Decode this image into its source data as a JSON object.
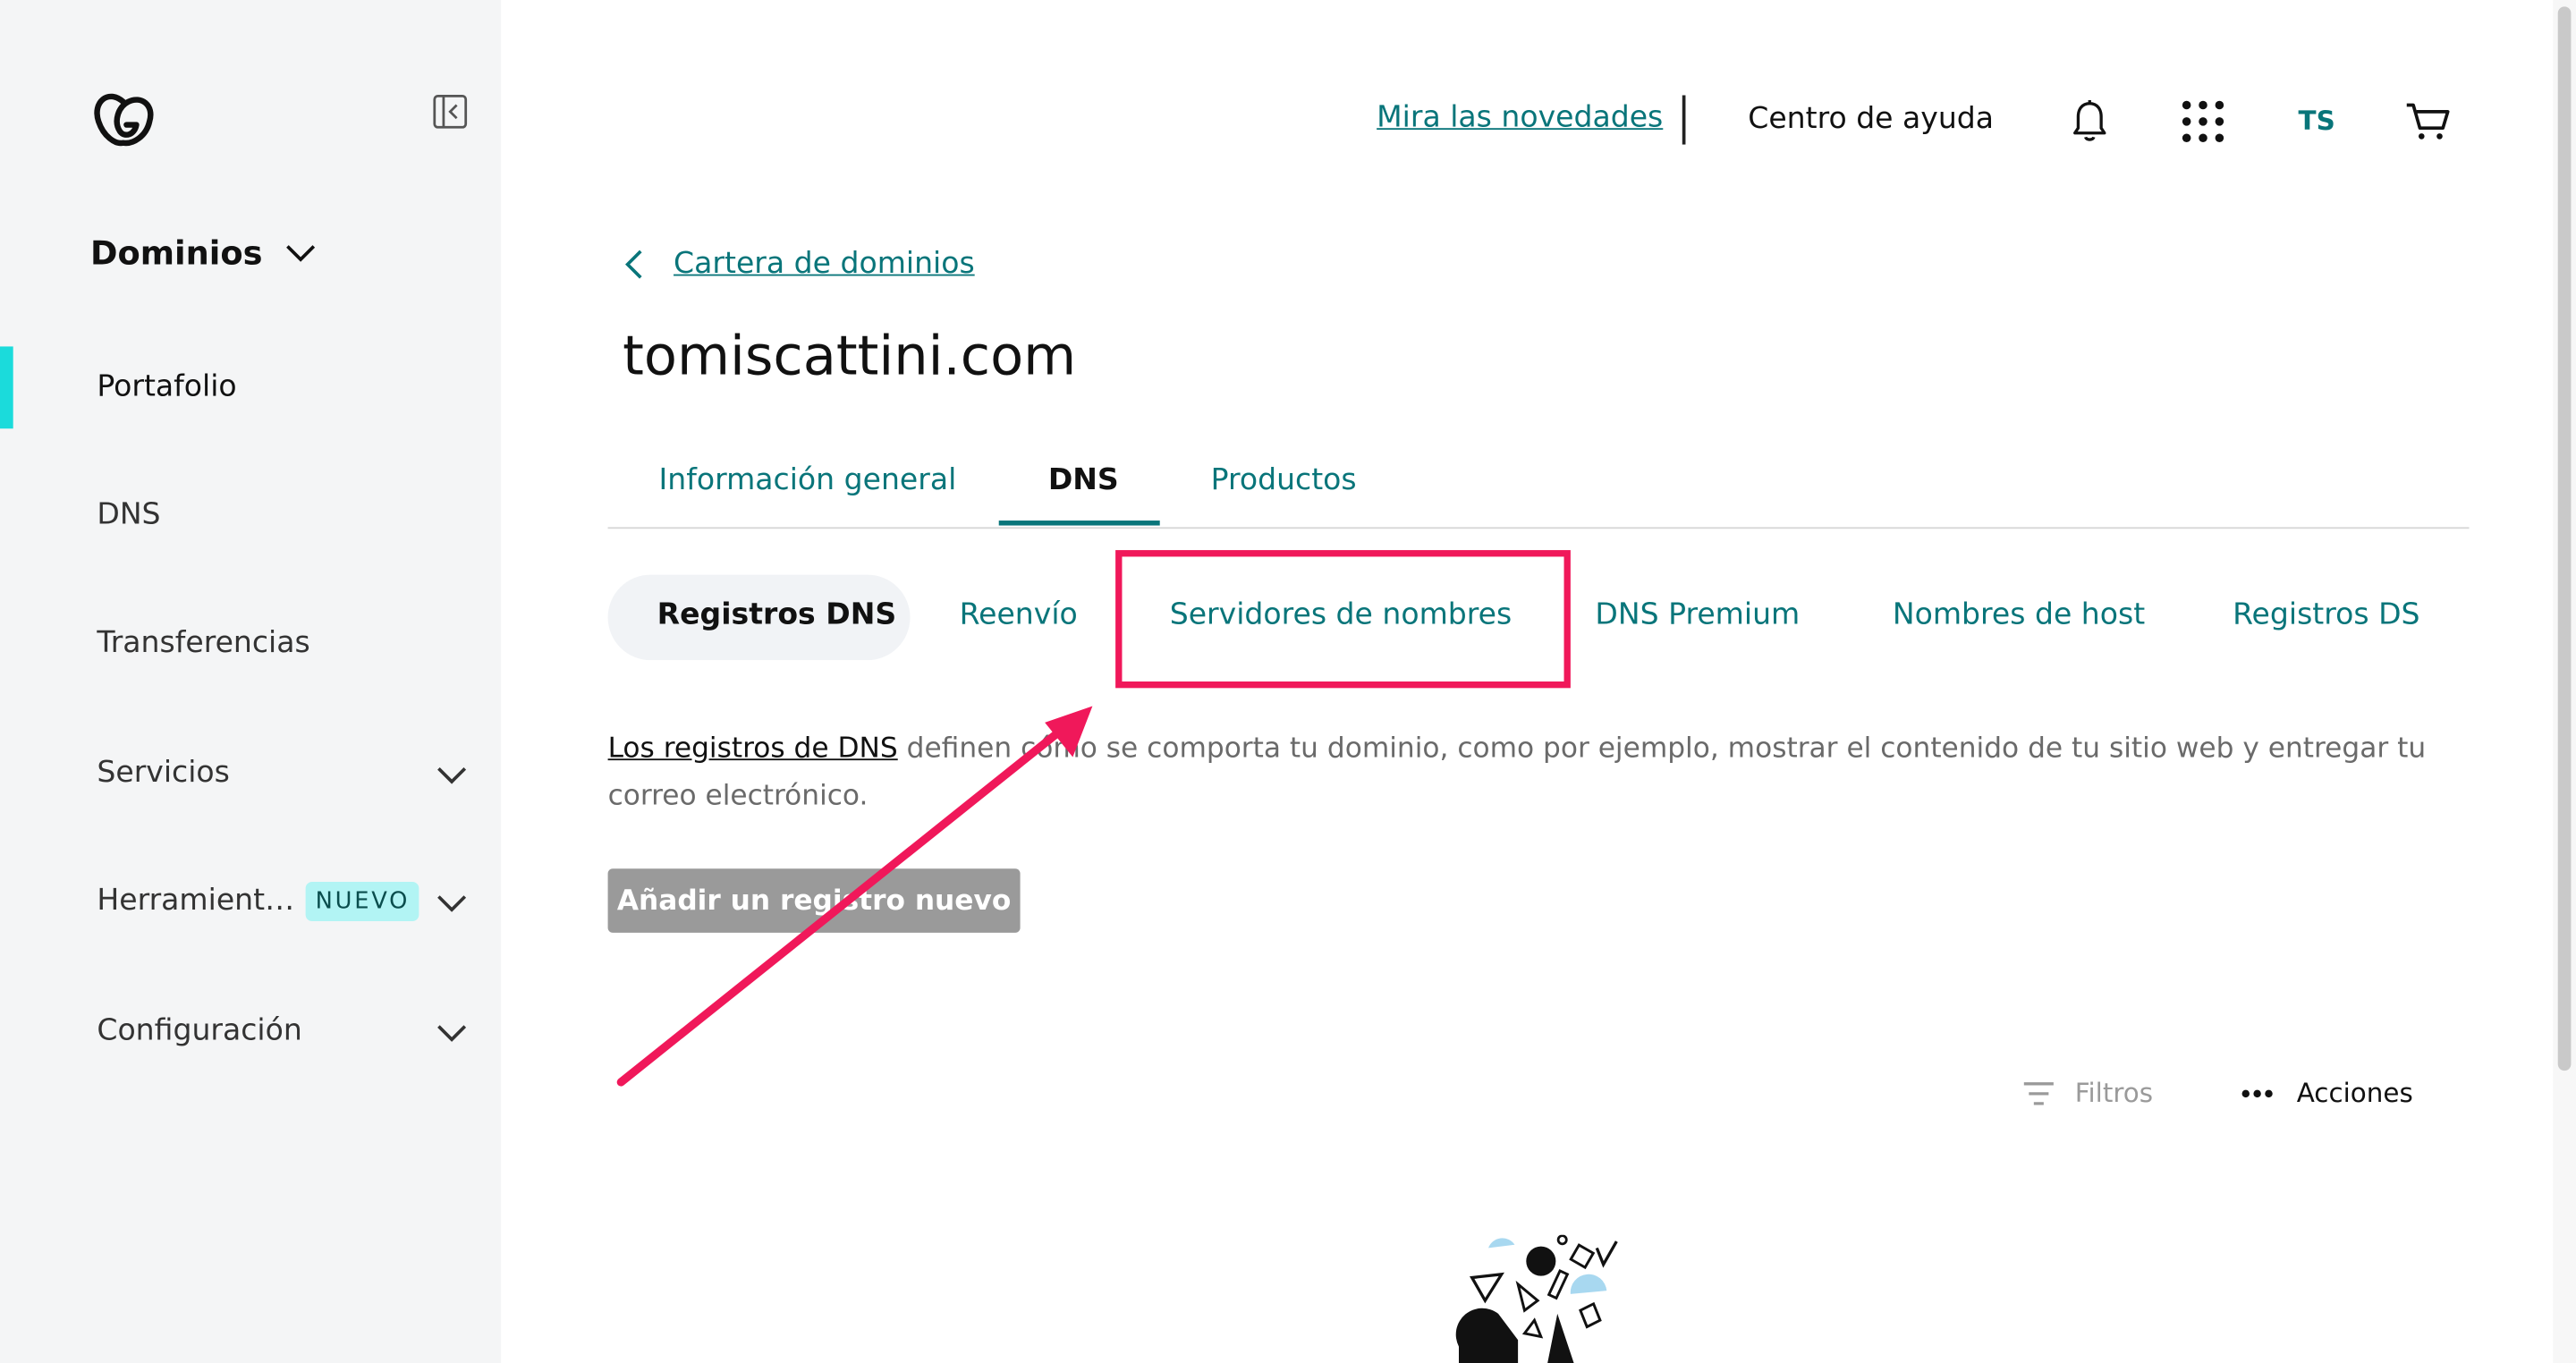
{
  "sidebar": {
    "section_title": "Dominios",
    "items": [
      {
        "label": "Portafolio"
      },
      {
        "label": "DNS"
      },
      {
        "label": "Transferencias"
      },
      {
        "label": "Servicios"
      },
      {
        "label": "Herramient…",
        "badge": "NUEVO"
      },
      {
        "label": "Configuración"
      }
    ]
  },
  "topbar": {
    "news_link": "Mira las novedades",
    "help": "Centro de ayuda",
    "user_initials": "TS"
  },
  "breadcrumb": {
    "back_label": "Cartera de dominios"
  },
  "page_title": "tomiscattini.com",
  "tabs": [
    {
      "label": "Información general"
    },
    {
      "label": "DNS"
    },
    {
      "label": "Productos"
    }
  ],
  "subtabs": [
    {
      "label": "Registros DNS"
    },
    {
      "label": "Reenvío"
    },
    {
      "label": "Servidores de nombres"
    },
    {
      "label": "DNS Premium"
    },
    {
      "label": "Nombres de host"
    },
    {
      "label": "Registros DS"
    }
  ],
  "description": {
    "link": "Los registros de DNS",
    "text": "definen cómo se comporta tu dominio, como por ejemplo, mostrar el contenido de tu sitio web y entregar tu correo electrónico."
  },
  "add_record_button": "Añadir un registro nuevo",
  "toolbar": {
    "filters": "Filtros",
    "actions": "Acciones"
  },
  "colors": {
    "accent": "#09757a",
    "highlight": "#f0185a",
    "active_bar": "#1bdbdb"
  }
}
